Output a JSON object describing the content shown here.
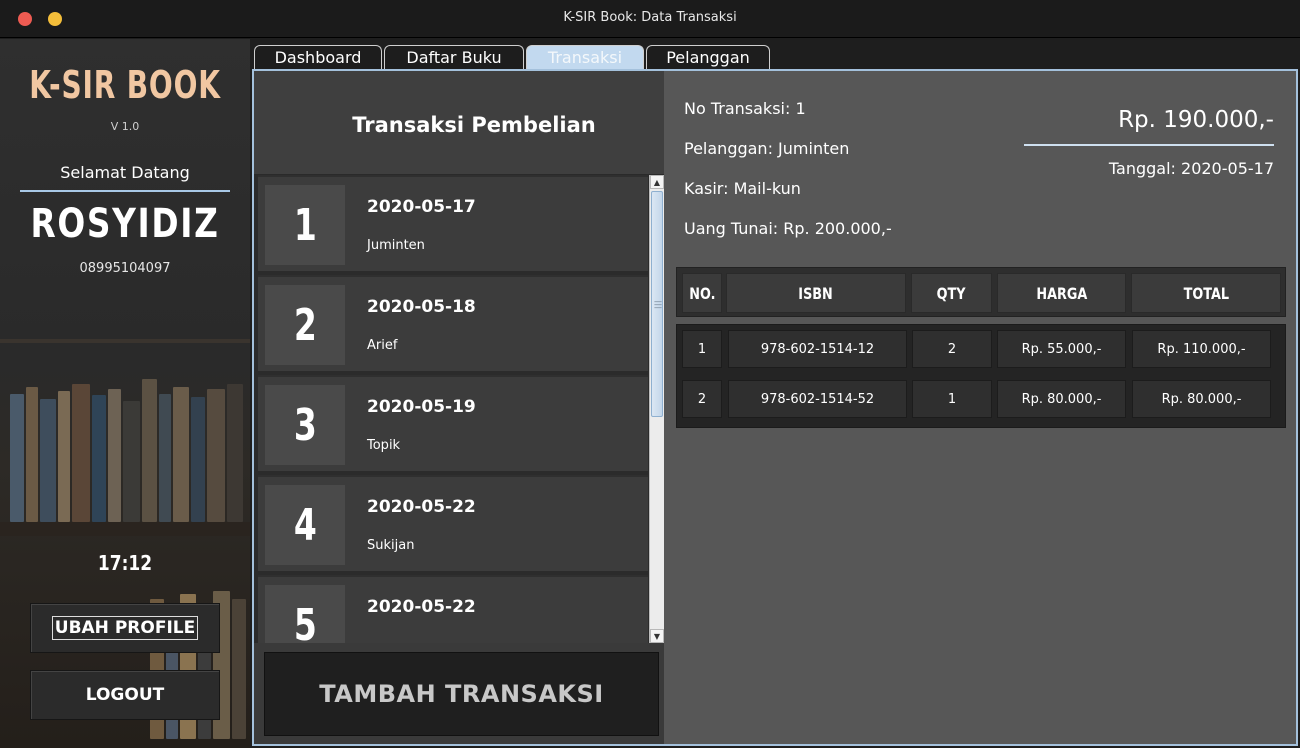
{
  "window": {
    "title": "K-SIR Book: Data Transaksi",
    "controls": [
      "close",
      "minimize"
    ]
  },
  "sidebar": {
    "brand": "K-SIR BOOK",
    "version": "V 1.0",
    "welcome": "Selamat Datang",
    "username": "ROSYIDIZ",
    "phone": "08995104097",
    "clock": "17:12",
    "profile_button": "UBAH PROFILE",
    "logout_button": "LOGOUT"
  },
  "tabs": [
    {
      "label": "Dashboard",
      "active": false
    },
    {
      "label": "Daftar Buku",
      "active": false
    },
    {
      "label": "Transaksi",
      "active": true
    },
    {
      "label": "Pelanggan",
      "active": false
    }
  ],
  "transactions": {
    "header": "Transaksi Pembelian",
    "items": [
      {
        "number": "1",
        "date": "2020-05-17",
        "customer": "Juminten"
      },
      {
        "number": "2",
        "date": "2020-05-18",
        "customer": "Arief"
      },
      {
        "number": "3",
        "date": "2020-05-19",
        "customer": "Topik"
      },
      {
        "number": "4",
        "date": "2020-05-22",
        "customer": "Sukijan"
      },
      {
        "number": "5",
        "date": "2020-05-22",
        "customer": ""
      }
    ],
    "add_button": "TAMBAH TRANSAKSI"
  },
  "detail": {
    "no_transaksi": "No Transaksi: 1",
    "pelanggan": "Pelanggan: Juminten",
    "kasir": "Kasir: Mail-kun",
    "uang_tunai": "Uang Tunai: Rp. 200.000,-",
    "total": "Rp. 190.000,-",
    "tanggal": "Tanggal: 2020-05-17",
    "table": {
      "headers": [
        "NO.",
        "ISBN",
        "QTY",
        "HARGA",
        "TOTAL"
      ],
      "rows": [
        [
          "1",
          "978-602-1514-12",
          "2",
          "Rp. 55.000,-",
          "Rp. 110.000,-"
        ],
        [
          "2",
          "978-602-1514-52",
          "1",
          "Rp. 80.000,-",
          "Rp. 80.000,-"
        ]
      ]
    }
  },
  "colors": {
    "brand": "#f1c7a2",
    "accent": "#a4c1dc",
    "active_tab": "#c2d9ef",
    "close": "#ee5b52",
    "minimize": "#f4be3a"
  }
}
